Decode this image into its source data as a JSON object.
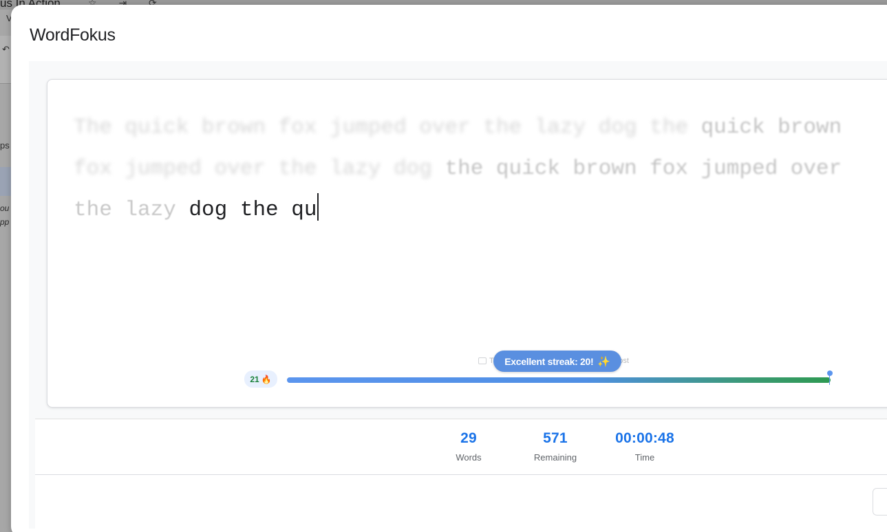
{
  "background": {
    "title": "us In Action",
    "title_icons": "☆ ⇥ ⟳",
    "snippet_v": "V",
    "snippet_undo": "↶",
    "snippet_ps": "ps",
    "snippet_ou": "ou",
    "snippet_pp": "pp"
  },
  "dialog": {
    "title": "WordFokus"
  },
  "editor": {
    "line1_faint": "The quick brown fox jumped over the lazy dog the ",
    "line1_mid": "quick brown",
    "line2_faint": "fox jumped over the lazy dog ",
    "line2_mid": "the quick brown fox jumped over",
    "line3_light": "the lazy ",
    "line3_typed": "dog the qu"
  },
  "mode_toggle": {
    "typewriter_label": "Ty",
    "ghost_label": "Ghost"
  },
  "toast": {
    "message": "Excellent streak: 20!",
    "icon": "sparkle-icon"
  },
  "streak": {
    "count": "21",
    "icon": "flame-icon"
  },
  "progress": {
    "fraction": 1.0
  },
  "stats": {
    "words_value": "29",
    "words_label": "Words",
    "remaining_value": "571",
    "remaining_label": "Remaining",
    "time_value": "00:00:48",
    "time_label": "Time"
  },
  "colors": {
    "accent": "#1a73e8",
    "progress_start": "#5b95ee",
    "progress_end": "#2e9a52",
    "toast_bg": "#5a8fe0"
  }
}
